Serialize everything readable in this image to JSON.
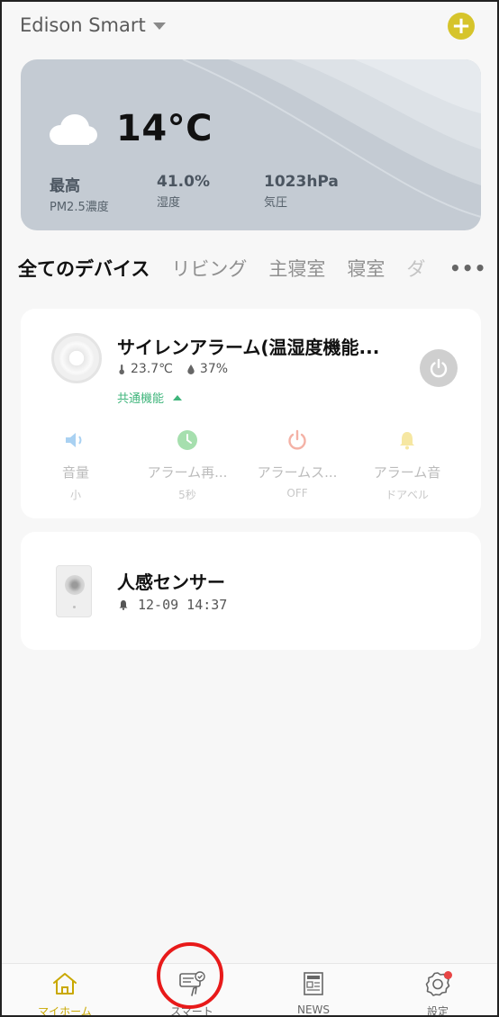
{
  "header": {
    "home_name": "Edison Smart",
    "add_label": "+"
  },
  "weather": {
    "icon": "cloud-icon",
    "temperature": "14°C",
    "metrics": [
      {
        "value": "最高",
        "label": "PM2.5濃度"
      },
      {
        "value": "41.0%",
        "label": "湿度"
      },
      {
        "value": "1023hPa",
        "label": "気圧"
      }
    ]
  },
  "tabs": {
    "items": [
      "全てのデバイス",
      "リビング",
      "主寝室",
      "寝室",
      "ダ"
    ],
    "more": "•••"
  },
  "devices": [
    {
      "name": "サイレンアラーム(温湿度機能...",
      "temperature": "23.7℃",
      "humidity": "37%",
      "common_functions": "共通機能",
      "functions": [
        {
          "icon": "speaker-icon",
          "label": "音量",
          "value": "小",
          "color": "#a9d1f2"
        },
        {
          "icon": "clock-icon",
          "label": "アラーム再...",
          "value": "5秒",
          "color": "#a6dfae"
        },
        {
          "icon": "power-icon",
          "label": "アラームス...",
          "value": "OFF",
          "color": "#f4b2a6"
        },
        {
          "icon": "bell-icon",
          "label": "アラーム音",
          "value": "ドアベル",
          "color": "#f6e7a2"
        }
      ]
    },
    {
      "name": "人感センサー",
      "timestamp": "12-09 14:37"
    }
  ],
  "bottom_nav": [
    {
      "label": "マイホーム",
      "icon": "home-icon"
    },
    {
      "label": "スマート",
      "icon": "smart-scene-icon"
    },
    {
      "label": "NEWS",
      "icon": "newspaper-icon"
    },
    {
      "label": "設定",
      "icon": "settings-icon"
    }
  ],
  "colors": {
    "accent": "#d6c42b",
    "active_nav": "#c9a800",
    "green": "#3fb57b",
    "highlight_circle": "#e81a1a"
  }
}
